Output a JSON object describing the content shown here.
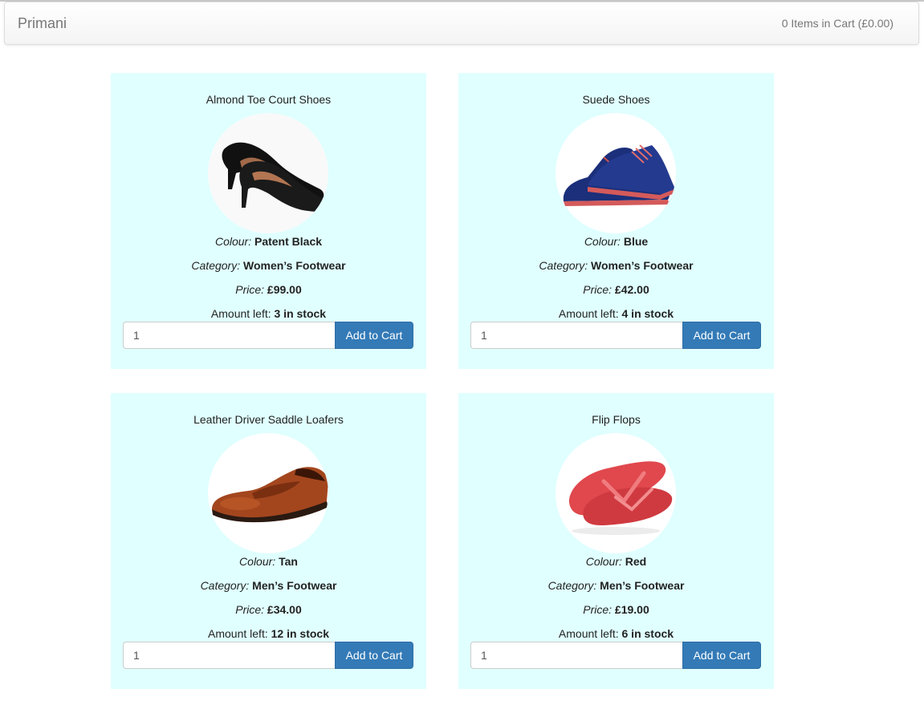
{
  "nav": {
    "brand": "Primani",
    "cart_summary": "0 Items in Cart (£0.00)"
  },
  "labels": {
    "colour": "Colour:",
    "category": "Category:",
    "price": "Price:",
    "amount_left": "Amount left:",
    "add_to_cart": "Add to Cart"
  },
  "products": [
    {
      "name": "Almond Toe Court Shoes",
      "image_icon": "black-court-shoes-image",
      "colour": "Patent Black",
      "category": "Women’s Footwear",
      "price": "£99.00",
      "stock": "3 in stock",
      "quantity": "1"
    },
    {
      "name": "Suede Shoes",
      "image_icon": "blue-suede-shoes-image",
      "colour": "Blue",
      "category": "Women’s Footwear",
      "price": "£42.00",
      "stock": "4 in stock",
      "quantity": "1"
    },
    {
      "name": "Leather Driver Saddle Loafers",
      "image_icon": "tan-loafer-image",
      "colour": "Tan",
      "category": "Men’s Footwear",
      "price": "£34.00",
      "stock": "12 in stock",
      "quantity": "1"
    },
    {
      "name": "Flip Flops",
      "image_icon": "red-flip-flops-image",
      "colour": "Red",
      "category": "Men’s Footwear",
      "price": "£19.00",
      "stock": "6 in stock",
      "quantity": "1"
    }
  ],
  "colors": {
    "card_background": "#e0ffff",
    "button": "#337ab7"
  }
}
